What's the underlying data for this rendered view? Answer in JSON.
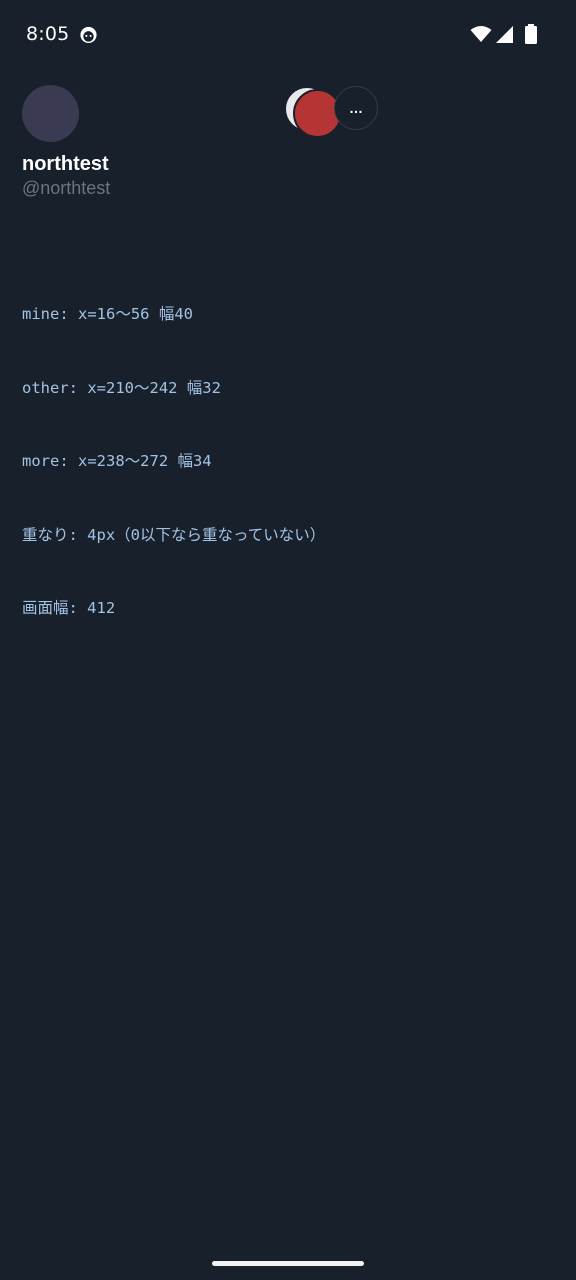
{
  "status_bar": {
    "time": "8:05",
    "app_icon": "mascot-face-icon",
    "wifi_icon": "wifi-icon",
    "signal_icon": "cell-signal-icon",
    "battery_icon": "battery-icon"
  },
  "profile": {
    "display_name": "northtest",
    "handle": "@northtest",
    "avatar_color": "#3a3a52"
  },
  "header_actions": {
    "other_avatar_back_color": "#e9e9e9",
    "other_avatar_front_color": "#b53535",
    "more_label": "…"
  },
  "debug": {
    "lines": [
      "mine: x=16〜56 幅40",
      "other: x=210〜242 幅32",
      "more: x=238〜272 幅34",
      "重なり: 4px（0以下なら重なっていない）",
      "画面幅: 412"
    ],
    "text_color": "#a3c3e5"
  },
  "colors": {
    "background": "#18202b",
    "muted_text": "#6c7480"
  }
}
